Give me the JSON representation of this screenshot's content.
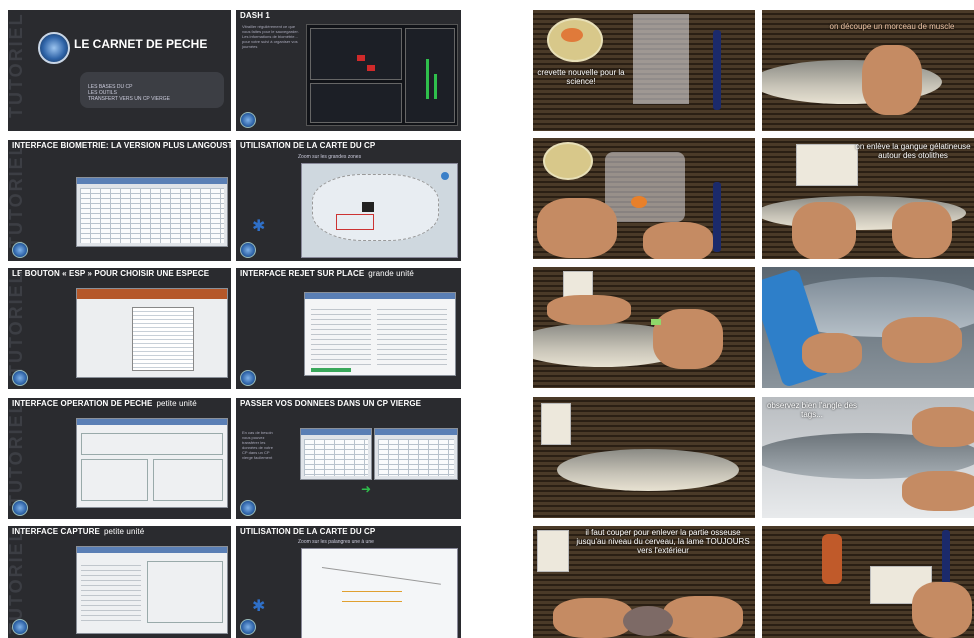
{
  "slides": [
    {
      "title": "LE CARNET DE PECHE",
      "subtitle": "",
      "side": "",
      "bullets": [
        "LES BASES DU CP",
        "LES OUTILS",
        "TRANSFERT VERS UN CP VIERGE"
      ],
      "footer": ""
    },
    {
      "title": "DASH 1",
      "subtitle": "",
      "side": "",
      "bullets": [],
      "footer": "Vitrailler régulièrement ce que vous faites pour le sauvegarder. Les informations de biométrie... pour votre suivi à organiser vos journées"
    },
    {
      "title": "INTERFACE BIOMETRIE: LA VERSION PLUS LANGOUSTE",
      "subtitle": "",
      "side": "",
      "bullets": [],
      "footer": ""
    },
    {
      "title": "UTILISATION DE LA CARTE DU CP",
      "subtitle": "Zoom sur les grandes zones",
      "side": "",
      "bullets": [],
      "footer": ""
    },
    {
      "title": "LE BOUTON « ESP » POUR CHOISIR UNE ESPECE",
      "subtitle": "",
      "side": "",
      "bullets": [],
      "footer": ""
    },
    {
      "title": "INTERFACE REJET SUR PLACE",
      "subtitle": "grande unité",
      "side": "",
      "bullets": [],
      "footer": ""
    },
    {
      "title": "INTERFACE OPERATION DE PECHE",
      "subtitle": "petite unité",
      "side": "",
      "bullets": [],
      "footer": ""
    },
    {
      "title": "PASSER VOS DONNEES DANS UN CP VIERGE",
      "subtitle": "",
      "side": "En cas de besoin vous pouvez transférer les données de votre CP dans un CP vierge facilement",
      "bullets": [],
      "footer": ""
    },
    {
      "title": "INTERFACE CAPTURE",
      "subtitle": "petite unité",
      "side": "",
      "bullets": [],
      "footer": ""
    },
    {
      "title": "UTILISATION DE LA CARTE DU CP",
      "subtitle": "Zoom sur les palangres une à une",
      "side": "",
      "bullets": [],
      "footer": ""
    }
  ],
  "tutoriel_label": "TUTORIEL",
  "photos": [
    {
      "caption": "crevette nouvelle pour la science!"
    },
    {
      "caption": "on découpe un morceau de muscle"
    },
    {
      "caption": ""
    },
    {
      "caption": "on enlève la gangue gélatineuse autour des otolithes"
    },
    {
      "caption": ""
    },
    {
      "caption": ""
    },
    {
      "caption": ""
    },
    {
      "caption": "observez bien l'angle des tags..."
    },
    {
      "caption": "il faut couper pour enlever la partie osseuse jusqu'au niveau du cerveau, la lame TOUJOURS vers l'extérieur"
    },
    {
      "caption": ""
    }
  ]
}
